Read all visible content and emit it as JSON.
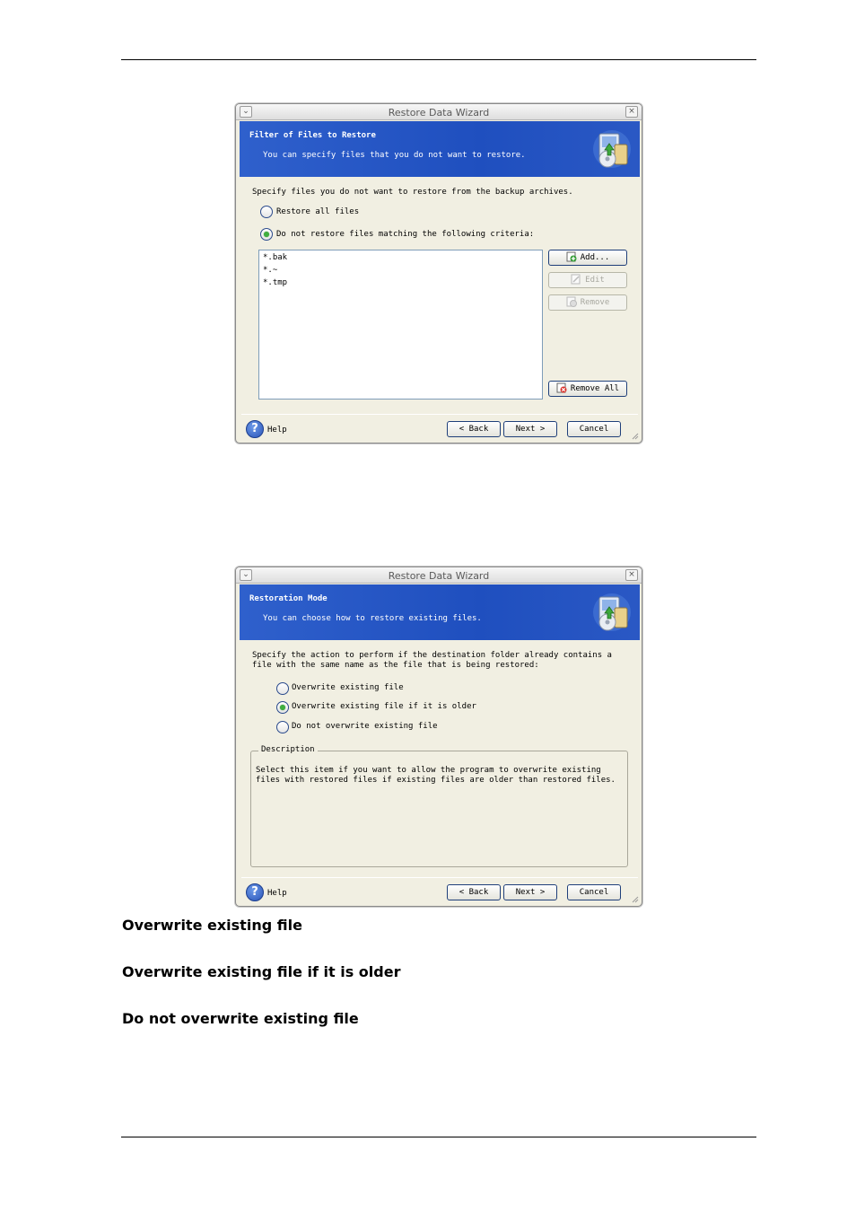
{
  "window1": {
    "title": "Restore Data Wizard",
    "banner_title": "Filter of Files to Restore",
    "banner_subtitle": "You can specify files that you do not want to restore.",
    "instruction": "Specify files you do not want to restore from the backup archives.",
    "radio_restore_all": "Restore all files",
    "radio_do_not_restore": "Do not restore files matching the following criteria:",
    "selected_option": "Do not restore files matching the following criteria:",
    "filters": [
      "*.bak",
      "*.~",
      "*.tmp"
    ],
    "buttons": {
      "add": "Add...",
      "edit": "Edit",
      "remove": "Remove",
      "remove_all": "Remove All"
    },
    "footer": {
      "help": "Help",
      "back": "< Back",
      "next": "Next >",
      "cancel": "Cancel"
    }
  },
  "window2": {
    "title": "Restore Data Wizard",
    "banner_title": "Restoration Mode",
    "banner_subtitle": "You can choose how to restore existing files.",
    "instruction_line1": "Specify the action to perform if the destination folder already contains a",
    "instruction_line2": "file with the same name as the file that is being restored:",
    "options": [
      "Overwrite existing file",
      "Overwrite existing file if it is older",
      "Do not overwrite existing file"
    ],
    "selected_option": "Overwrite existing file if it is older",
    "description_label": "Description",
    "description_line1": "Select this item if you want to allow the program to overwrite existing",
    "description_line2": "files with restored files if existing files are older than restored files.",
    "footer": {
      "help": "Help",
      "back": "< Back",
      "next": "Next >",
      "cancel": "Cancel"
    }
  },
  "captions": [
    "Overwrite existing file",
    "Overwrite existing file if it is older",
    "Do not overwrite existing file"
  ],
  "colors": {
    "banner_blue": "#2453c4",
    "window_bg": "#f1efe2",
    "radio_selected": "#3fae3f"
  }
}
